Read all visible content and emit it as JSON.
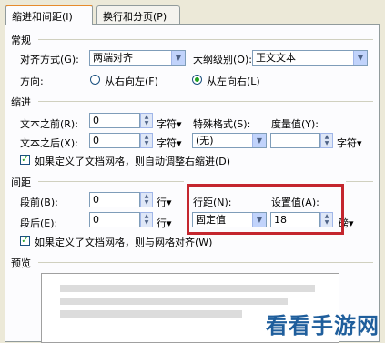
{
  "tabs": [
    {
      "label": "缩进和间距(I)"
    },
    {
      "label": "换行和分页(P)"
    }
  ],
  "general": {
    "title": "常规",
    "alignment_label": "对齐方式(G):",
    "alignment_value": "两端对齐",
    "outline_label": "大纲级别(O):",
    "outline_value": "正文文本",
    "direction_label": "方向:",
    "rtl_label": "从右向左(F)",
    "ltr_label": "从左向右(L)"
  },
  "indent": {
    "title": "缩进",
    "before_label": "文本之前(R):",
    "before_value": "0",
    "before_unit": "字符▾",
    "after_label": "文本之后(X):",
    "after_value": "0",
    "after_unit": "字符▾",
    "special_label": "特殊格式(S):",
    "special_value": "(无)",
    "measure_label": "度量值(Y):",
    "measure_value": "",
    "measure_unit": "字符▾",
    "grid_check_label": "如果定义了文档网格，则自动调整右缩进(D)"
  },
  "spacing": {
    "title": "间距",
    "before_label": "段前(B):",
    "before_value": "0",
    "before_unit": "行▾",
    "after_label": "段后(E):",
    "after_value": "0",
    "after_unit": "行▾",
    "line_label": "行距(N):",
    "line_value": "固定值",
    "setting_label": "设置值(A):",
    "setting_value": "18",
    "setting_unit": "磅▾",
    "grid_check_label": "如果定义了文档网格，则与网格对齐(W)"
  },
  "preview": {
    "title": "预览"
  },
  "watermark": "看看手游网",
  "colors": {
    "highlight": "#c4262e",
    "active_tab_accent": "#e68b2c"
  }
}
